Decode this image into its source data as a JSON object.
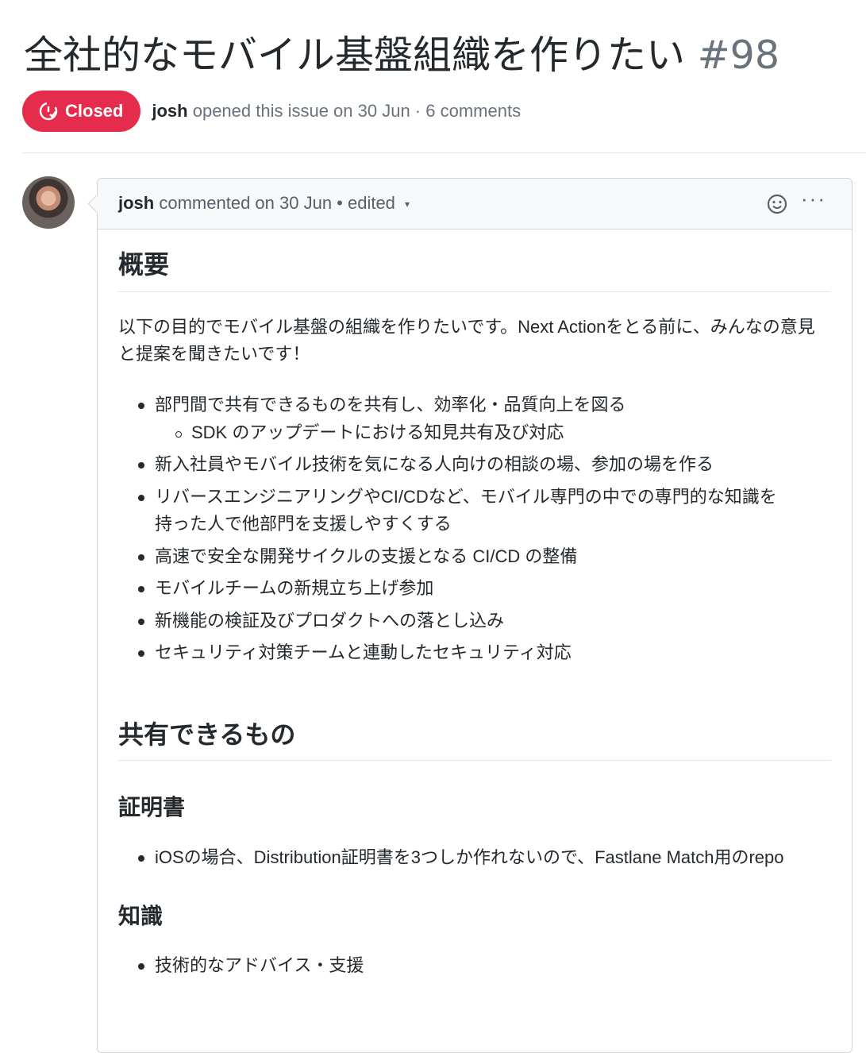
{
  "issue": {
    "title": "全社的なモバイル基盤組織を作りたい",
    "number": "#98",
    "state_label": "Closed",
    "state_color": "#e62c4d",
    "author": "josh",
    "meta_rest": "opened this issue on 30 Jun · 6 comments"
  },
  "comment": {
    "author": "josh",
    "meta": "commented on 30 Jun • edited",
    "caret": "▾",
    "more": "···",
    "h_overview": "概要",
    "intro": "以下の目的でモバイル基盤の組織を作りたいです。Next Actionをとる前に、みんなの意見と提案を聞きたいです！",
    "goals": [
      "部門間で共有できるものを共有し、効率化・品質向上を図る",
      "SDK のアップデートにおける知見共有及び対応",
      "新入社員やモバイル技術を気になる人向けの相談の場、参加の場を作る",
      "リバースエンジニアリングやCI/CDなど、モバイル専門の中での専門的な知識を",
      "持った人で他部門を支援しやすくする",
      "高速で安全な開発サイクルの支援となる CI/CD の整備",
      "モバイルチームの新規立ち上げ参加",
      "新機能の検証及びプロダクトへの落とし込み",
      "セキュリティ対策チームと連動したセキュリティ対応"
    ],
    "h_shareable": "共有できるもの",
    "h_certs": "証明書",
    "cert_item": "iOSの場合、Distribution証明書を3つしか作れないので、Fastlane Match用のrepo",
    "h_knowledge": "知識",
    "knowledge_item": "技術的なアドバイス・支援"
  }
}
